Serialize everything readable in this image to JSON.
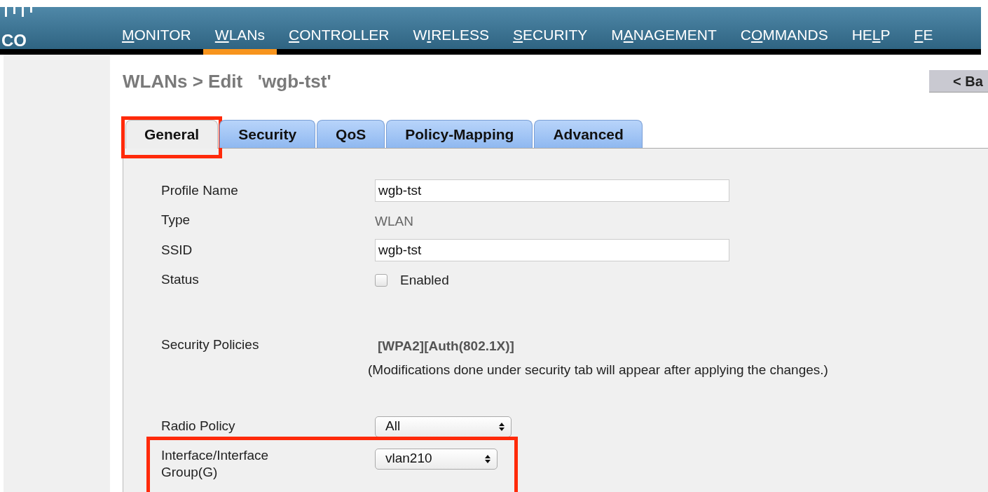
{
  "logo": {
    "text": "CO"
  },
  "nav": [
    {
      "key": "M",
      "after": "ONITOR",
      "selected": false
    },
    {
      "key": "W",
      "after": "LANs",
      "selected": true
    },
    {
      "key": "C",
      "after": "ONTROLLER",
      "selected": false
    },
    {
      "before": "W",
      "key": "I",
      "after": "RELESS",
      "selected": false
    },
    {
      "key": "S",
      "after": "ECURITY",
      "selected": false
    },
    {
      "before": "M",
      "key": "A",
      "after": "NAGEMENT",
      "selected": false
    },
    {
      "before": "C",
      "key": "O",
      "after": "MMANDS",
      "selected": false
    },
    {
      "before": "HE",
      "key": "L",
      "after": "P",
      "selected": false
    },
    {
      "key": "F",
      "after": "E",
      "selected": false
    }
  ],
  "page_title": "WLANs > Edit   'wgb-tst'",
  "back_button": "< Ba",
  "tabs": [
    {
      "label": "General",
      "selected": true,
      "highlighted": true
    },
    {
      "label": "Security",
      "selected": false,
      "highlighted": false
    },
    {
      "label": "QoS",
      "selected": false,
      "highlighted": false
    },
    {
      "label": "Policy-Mapping",
      "selected": false,
      "highlighted": false
    },
    {
      "label": "Advanced",
      "selected": false,
      "highlighted": false
    }
  ],
  "groups": [
    {
      "fields": [
        {
          "kind": "text",
          "label": "Profile Name",
          "value": "wgb-tst",
          "highlighted": false
        },
        {
          "kind": "static",
          "label": "Type",
          "value": "WLAN",
          "highlighted": false
        },
        {
          "kind": "text",
          "label": "SSID",
          "value": "wgb-tst",
          "highlighted": false
        },
        {
          "kind": "checkbox",
          "label": "Status",
          "value": "Enabled",
          "checked": false,
          "highlighted": false
        }
      ]
    },
    {
      "fields": [
        {
          "kind": "policy",
          "label": "Security Policies",
          "value": "[WPA2][Auth(802.1X)]",
          "note": "(Modifications done under security tab will appear after applying the changes.)",
          "highlighted": false
        }
      ]
    },
    {
      "fields": [
        {
          "kind": "select",
          "label": "Radio Policy",
          "value": "All",
          "highlighted": false
        },
        {
          "kind": "select",
          "label": "Interface/Interface Group(G)",
          "value": "vlan210",
          "highlighted": true
        }
      ]
    }
  ]
}
